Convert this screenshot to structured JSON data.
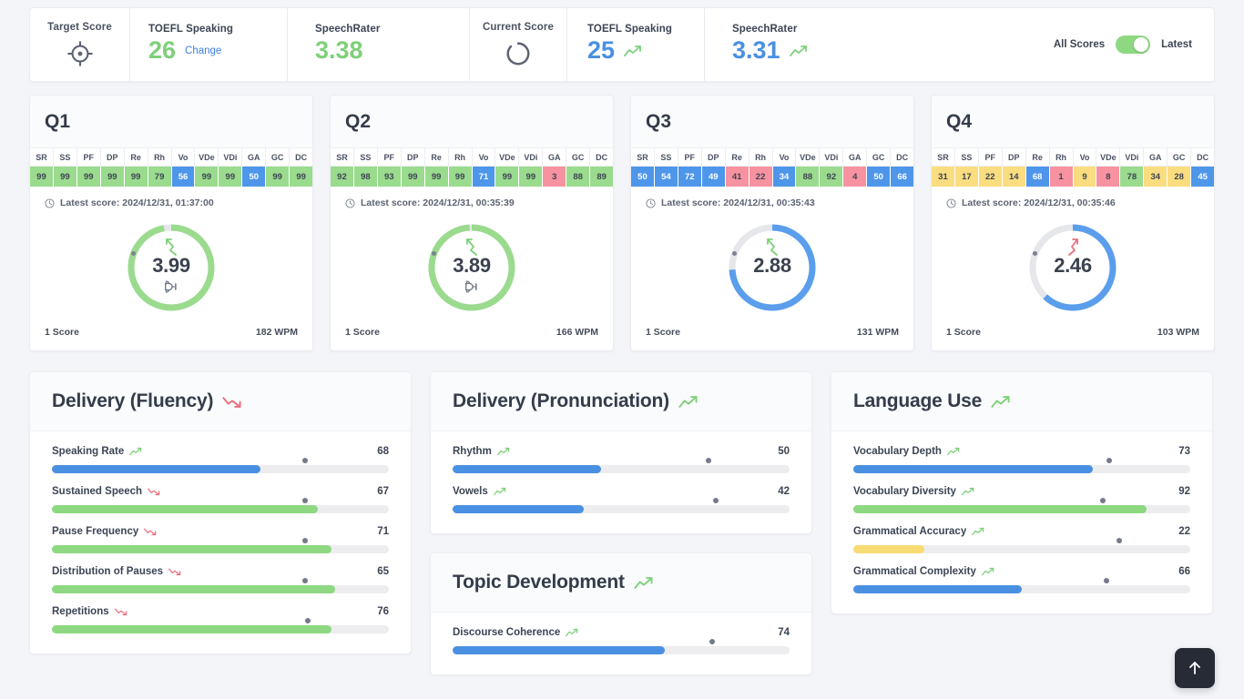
{
  "header": {
    "target_label": "Target Score",
    "current_label": "Current Score",
    "target_icon": "crosshair-target-icon",
    "current_icon": "progress-ring-icon",
    "target": {
      "toefl_title": "TOEFL Speaking",
      "toefl_value": "26",
      "change_label": "Change",
      "speechrater_title": "SpeechRater",
      "speechrater_value": "3.38",
      "color": "#7ed07a"
    },
    "current": {
      "toefl_title": "TOEFL Speaking",
      "toefl_value": "25",
      "toefl_trend": "trend-up-icon",
      "speechrater_title": "SpeechRater",
      "speechrater_value": "3.31",
      "speechrater_trend": "trend-up-icon",
      "color": "#4a90e2"
    },
    "toggle": {
      "left_label": "All Scores",
      "right_label": "Latest",
      "state": "Latest",
      "on_color": "#8ed882"
    }
  },
  "chip_headers": [
    "SR",
    "SS",
    "PF",
    "DP",
    "Re",
    "Rh",
    "Vo",
    "VDe",
    "VDi",
    "GA",
    "GC",
    "DC"
  ],
  "questions": [
    {
      "title": "Q1",
      "chips": [
        {
          "v": "99",
          "c": "green"
        },
        {
          "v": "99",
          "c": "green"
        },
        {
          "v": "99",
          "c": "green"
        },
        {
          "v": "99",
          "c": "green"
        },
        {
          "v": "99",
          "c": "green"
        },
        {
          "v": "79",
          "c": "green"
        },
        {
          "v": "56",
          "c": "blue"
        },
        {
          "v": "99",
          "c": "green"
        },
        {
          "v": "99",
          "c": "green"
        },
        {
          "v": "50",
          "c": "blue"
        },
        {
          "v": "99",
          "c": "green"
        },
        {
          "v": "99",
          "c": "green"
        }
      ],
      "latest_label": "Latest score: 2024/12/31, 01:37:00",
      "score": "3.99",
      "trend": "up",
      "gauge_color": "#9adb8e",
      "gauge_percent": 97,
      "has_trophy": true,
      "count_label": "1 Score",
      "wpm_label": "182 WPM"
    },
    {
      "title": "Q2",
      "chips": [
        {
          "v": "92",
          "c": "green"
        },
        {
          "v": "98",
          "c": "green"
        },
        {
          "v": "93",
          "c": "green"
        },
        {
          "v": "99",
          "c": "green"
        },
        {
          "v": "99",
          "c": "green"
        },
        {
          "v": "99",
          "c": "green"
        },
        {
          "v": "71",
          "c": "blue"
        },
        {
          "v": "99",
          "c": "green"
        },
        {
          "v": "99",
          "c": "green"
        },
        {
          "v": "3",
          "c": "red"
        },
        {
          "v": "88",
          "c": "green"
        },
        {
          "v": "89",
          "c": "green"
        }
      ],
      "latest_label": "Latest score: 2024/12/31, 00:35:39",
      "score": "3.89",
      "trend": "up",
      "gauge_color": "#9adb8e",
      "gauge_percent": 99,
      "has_trophy": true,
      "count_label": "1 Score",
      "wpm_label": "166 WPM"
    },
    {
      "title": "Q3",
      "chips": [
        {
          "v": "50",
          "c": "blue"
        },
        {
          "v": "54",
          "c": "blue"
        },
        {
          "v": "72",
          "c": "blue"
        },
        {
          "v": "49",
          "c": "blue"
        },
        {
          "v": "41",
          "c": "red"
        },
        {
          "v": "22",
          "c": "red"
        },
        {
          "v": "34",
          "c": "blue"
        },
        {
          "v": "88",
          "c": "green"
        },
        {
          "v": "92",
          "c": "green"
        },
        {
          "v": "4",
          "c": "red"
        },
        {
          "v": "50",
          "c": "blue"
        },
        {
          "v": "66",
          "c": "blue"
        }
      ],
      "latest_label": "Latest score: 2024/12/31, 00:35:43",
      "score": "2.88",
      "trend": "up",
      "gauge_color": "#5a9eec",
      "gauge_percent": 74,
      "has_trophy": false,
      "count_label": "1 Score",
      "wpm_label": "131 WPM"
    },
    {
      "title": "Q4",
      "chips": [
        {
          "v": "31",
          "c": "yellow"
        },
        {
          "v": "17",
          "c": "yellow"
        },
        {
          "v": "22",
          "c": "yellow"
        },
        {
          "v": "14",
          "c": "yellow"
        },
        {
          "v": "68",
          "c": "blue"
        },
        {
          "v": "1",
          "c": "red"
        },
        {
          "v": "9",
          "c": "yellow"
        },
        {
          "v": "8",
          "c": "red"
        },
        {
          "v": "78",
          "c": "green"
        },
        {
          "v": "34",
          "c": "yellow"
        },
        {
          "v": "28",
          "c": "yellow"
        },
        {
          "v": "45",
          "c": "blue"
        }
      ],
      "latest_label": "Latest score: 2024/12/31, 00:35:46",
      "score": "2.46",
      "trend": "down",
      "gauge_color": "#5a9eec",
      "gauge_percent": 62,
      "has_trophy": false,
      "count_label": "1 Score",
      "wpm_label": "103 WPM"
    }
  ],
  "panels": [
    {
      "title": "Delivery (Fluency)",
      "trend": "down",
      "items": [
        {
          "label": "Speaking Rate",
          "trend": "up",
          "value": "68",
          "fill": 62,
          "fill_color": "blue",
          "marker": 75
        },
        {
          "label": "Sustained Speech",
          "trend": "down",
          "value": "67",
          "fill": 79,
          "fill_color": "green",
          "marker": 75
        },
        {
          "label": "Pause Frequency",
          "trend": "down",
          "value": "71",
          "fill": 83,
          "fill_color": "green",
          "marker": 75
        },
        {
          "label": "Distribution of Pauses",
          "trend": "down",
          "value": "65",
          "fill": 84,
          "fill_color": "green",
          "marker": 75
        },
        {
          "label": "Repetitions",
          "trend": "down",
          "value": "76",
          "fill": 83,
          "fill_color": "green",
          "marker": 76
        }
      ]
    },
    {
      "title": "Delivery (Pronunciation)",
      "trend": "up",
      "items": [
        {
          "label": "Rhythm",
          "trend": "up",
          "value": "50",
          "fill": 44,
          "fill_color": "blue",
          "marker": 76
        },
        {
          "label": "Vowels",
          "trend": "up",
          "value": "42",
          "fill": 39,
          "fill_color": "blue",
          "marker": 78
        }
      ]
    },
    {
      "title": "Topic Development",
      "trend": "up",
      "items": [
        {
          "label": "Discourse Coherence",
          "trend": "up",
          "value": "74",
          "fill": 63,
          "fill_color": "blue",
          "marker": 77
        }
      ]
    },
    {
      "title": "Language Use",
      "trend": "up",
      "items": [
        {
          "label": "Vocabulary Depth",
          "trend": "up",
          "value": "73",
          "fill": 71,
          "fill_color": "blue",
          "marker": 76
        },
        {
          "label": "Vocabulary Diversity",
          "trend": "up",
          "value": "92",
          "fill": 87,
          "fill_color": "green",
          "marker": 74
        },
        {
          "label": "Grammatical Accuracy",
          "trend": "up",
          "value": "22",
          "fill": 21,
          "fill_color": "yellow",
          "marker": 79
        },
        {
          "label": "Grammatical Complexity",
          "trend": "up",
          "value": "66",
          "fill": 50,
          "fill_color": "blue",
          "marker": 75
        }
      ]
    }
  ],
  "fab": {
    "icon": "arrow-up-icon",
    "label": "Scroll to top"
  }
}
